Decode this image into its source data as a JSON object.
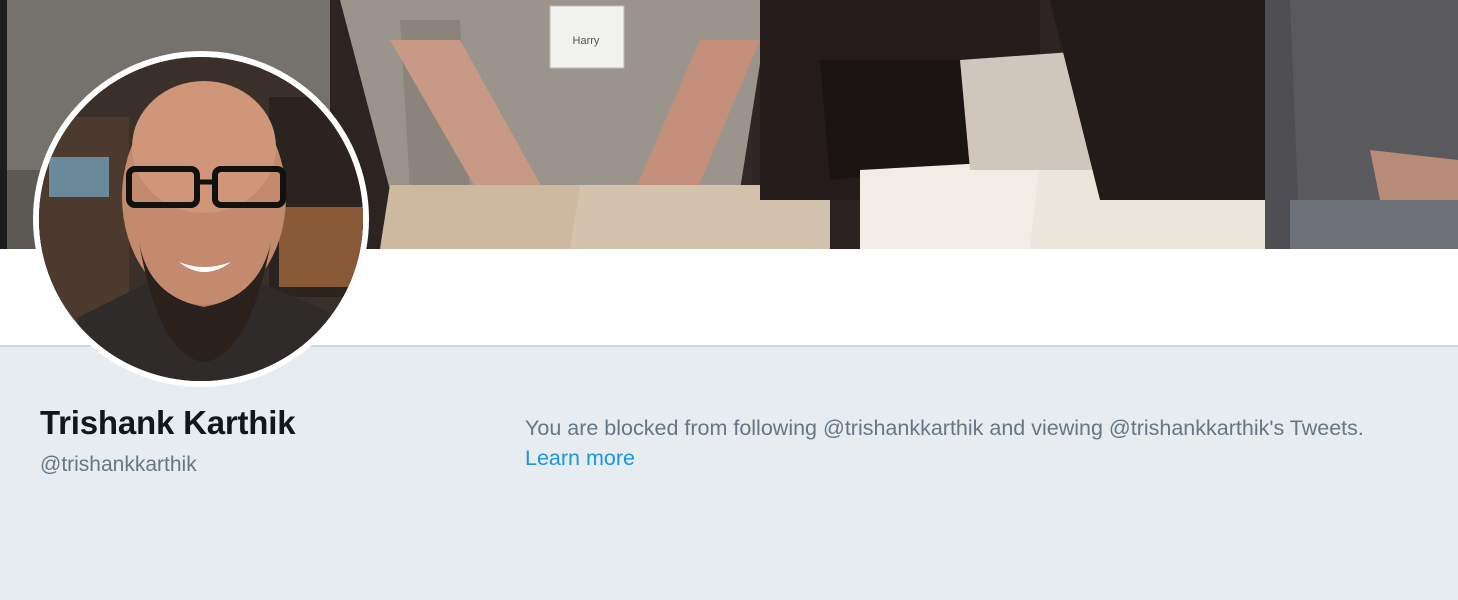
{
  "profile": {
    "name": "Trishank Karthik",
    "handle": "@trishankkarthik"
  },
  "notice": {
    "text": "You are blocked from following @trishankkarthik and viewing @trishankkarthik's Tweets.",
    "link_label": "Learn more"
  },
  "banner": {
    "name_tag_text": "Harry"
  },
  "colors": {
    "page_background": "#e6ecf0",
    "name_text": "#14171a",
    "secondary_text": "#657786",
    "link": "#1b95e0",
    "nav_bar": "#ffffff"
  }
}
